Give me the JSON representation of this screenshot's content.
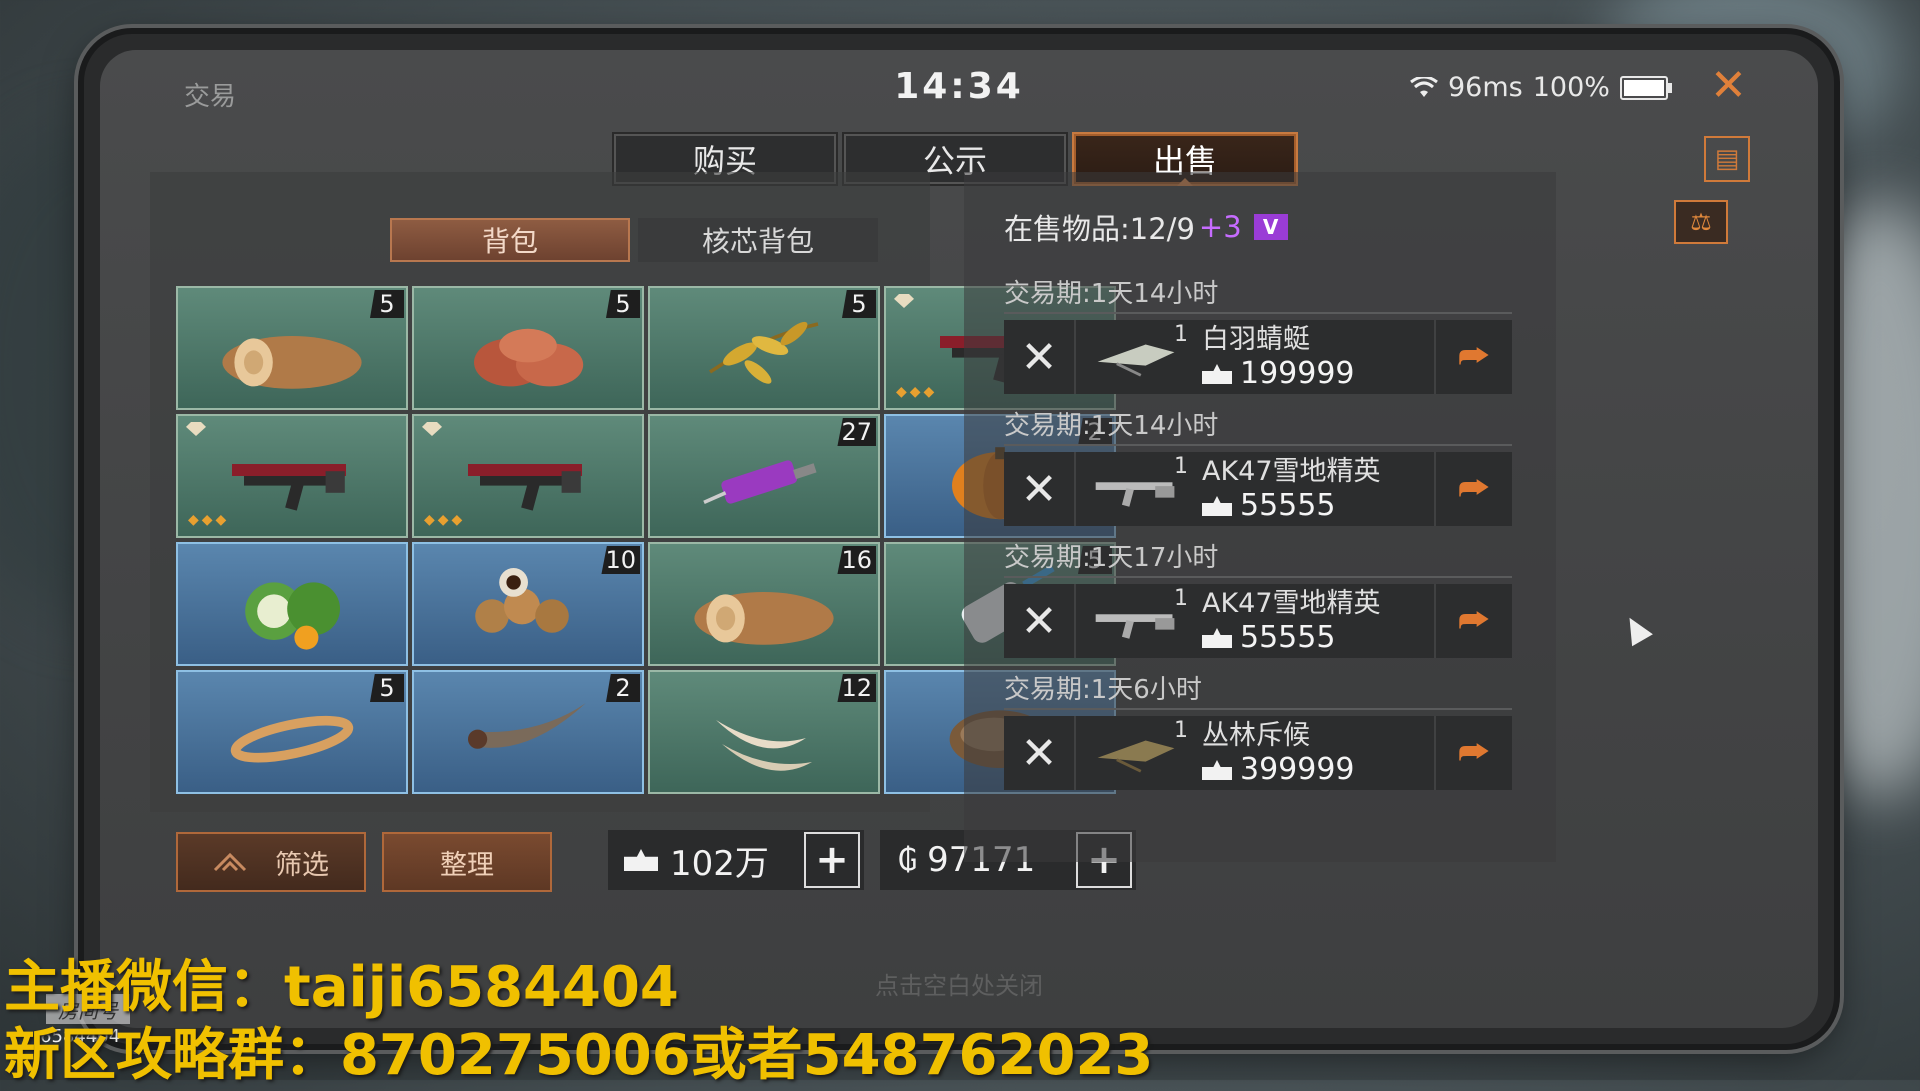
{
  "status": {
    "window_title": "交易",
    "time": "14:34",
    "ping": "96ms",
    "battery": "100%",
    "battery_level": 1.0
  },
  "tabs": [
    {
      "label": "购买",
      "active": false
    },
    {
      "label": "公示",
      "active": false
    },
    {
      "label": "出售",
      "active": true
    }
  ],
  "subtabs": [
    {
      "label": "背包",
      "active": true
    },
    {
      "label": "核芯背包",
      "active": false
    }
  ],
  "inventory": [
    {
      "icon": "wood-log-icon",
      "count": "5",
      "bg": "green"
    },
    {
      "icon": "raw-meat-icon",
      "count": "5",
      "bg": "green"
    },
    {
      "icon": "herb-leaves-icon",
      "count": "5",
      "bg": "green"
    },
    {
      "icon": "rifle-icon",
      "count": "",
      "bg": "green",
      "locked": true
    },
    {
      "icon": "rifle-icon",
      "count": "",
      "bg": "green",
      "locked": true
    },
    {
      "icon": "rifle-icon",
      "count": "",
      "bg": "green",
      "locked": true
    },
    {
      "icon": "syringe-icon",
      "count": "27",
      "bg": "green"
    },
    {
      "icon": "pumpkin-icon",
      "count": "2",
      "bg": "blue"
    },
    {
      "icon": "coconut-flower-icon",
      "count": "",
      "bg": "blue"
    },
    {
      "icon": "longan-fruit-icon",
      "count": "10",
      "bg": "blue"
    },
    {
      "icon": "wood-log-icon",
      "count": "16",
      "bg": "green"
    },
    {
      "icon": "glue-bottle-icon",
      "count": "5",
      "bg": "green"
    },
    {
      "icon": "rubber-band-icon",
      "count": "5",
      "bg": "blue"
    },
    {
      "icon": "horn-icon",
      "count": "2",
      "bg": "blue"
    },
    {
      "icon": "fangs-icon",
      "count": "12",
      "bg": "green"
    },
    {
      "icon": "fur-icon",
      "count": "",
      "bg": "blue"
    }
  ],
  "buttons": {
    "filter": "筛选",
    "sort": "整理"
  },
  "currency": {
    "gold": "102万",
    "coins": "97171"
  },
  "on_sale": {
    "label": "在售物品:12/9",
    "bonus": "+3",
    "vip": "V"
  },
  "listings": [
    {
      "period": "交易期:1天14小时",
      "qty": "1",
      "name": "白羽蜻蜓",
      "price": "199999",
      "icon": "dragonfly-skin-icon"
    },
    {
      "period": "交易期:1天14小时",
      "qty": "1",
      "name": "AK47雪地精英",
      "price": "55555",
      "icon": "ak47-icon"
    },
    {
      "period": "交易期:1天17小时",
      "qty": "1",
      "name": "AK47雪地精英",
      "price": "55555",
      "icon": "ak47-icon"
    },
    {
      "period": "交易期:1天6小时",
      "qty": "1",
      "name": "丛林斥候",
      "price": "399999",
      "icon": "jungle-scout-icon"
    }
  ],
  "hint": "点击空白处关闭",
  "overlay": {
    "line1": "主播微信：taiji6584404",
    "line2": "新区攻略群：870275006或者548762023",
    "room_label": "房间号",
    "room_number": "6584404"
  },
  "colors": {
    "accent": "#d07a3a",
    "overlay_text": "#f0c000",
    "vip": "#9a3cd6"
  }
}
